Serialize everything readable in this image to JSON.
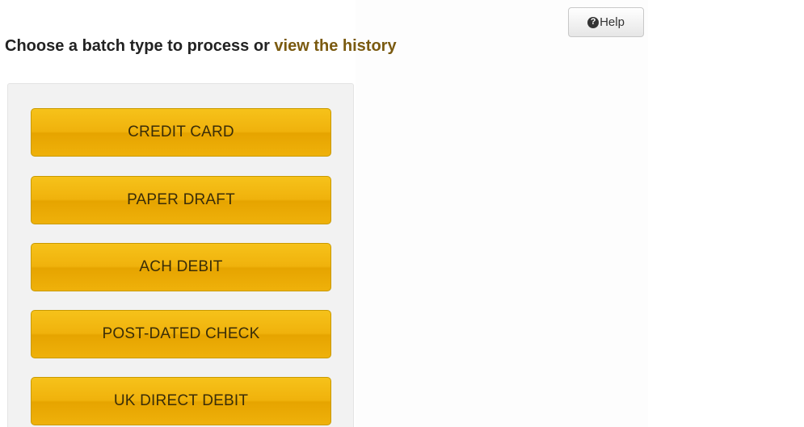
{
  "help": {
    "icon_glyph": "?",
    "label": "Help"
  },
  "heading": {
    "prefix": "Choose a batch type to process or ",
    "link": "view the history"
  },
  "batch_types": [
    {
      "label": "CREDIT CARD"
    },
    {
      "label": "PAPER DRAFT"
    },
    {
      "label": "ACH DEBIT"
    },
    {
      "label": "POST-DATED CHECK"
    },
    {
      "label": "UK DIRECT DEBIT"
    }
  ],
  "colors": {
    "button_gold": "#f0b20c",
    "link_brown": "#7a5a10",
    "panel_gray": "#f2f2f2"
  }
}
